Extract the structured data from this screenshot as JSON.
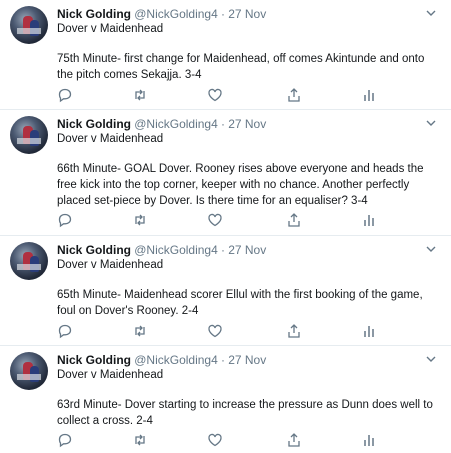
{
  "tweets": [
    {
      "name": "Nick Golding",
      "handle": "@NickGolding4",
      "separator": "·",
      "date": "27 Nov",
      "subtitle": "Dover v Maidenhead",
      "text": "75th Minute- first change for Maidenhead, off comes Akintunde and onto the pitch comes Sekajja. 3-4"
    },
    {
      "name": "Nick Golding",
      "handle": "@NickGolding4",
      "separator": "·",
      "date": "27 Nov",
      "subtitle": "Dover v Maidenhead",
      "text": "66th Minute- GOAL Dover. Rooney rises above everyone and heads the free kick into the top corner, keeper with no chance. Another perfectly placed set-piece by Dover. Is there time for an equaliser? 3-4"
    },
    {
      "name": "Nick Golding",
      "handle": "@NickGolding4",
      "separator": "·",
      "date": "27 Nov",
      "subtitle": "Dover v Maidenhead",
      "text": "65th Minute- Maidenhead scorer Ellul with the first booking of the game, foul on Dover's Rooney. 2-4"
    },
    {
      "name": "Nick Golding",
      "handle": "@NickGolding4",
      "separator": "·",
      "date": "27 Nov",
      "subtitle": "Dover v Maidenhead",
      "text": "63rd Minute- Dover starting to increase the pressure as Dunn does well to collect a cross. 2-4"
    }
  ],
  "icons": {
    "reply": "reply-icon",
    "retweet": "retweet-icon",
    "like": "heart-icon",
    "share": "share-icon",
    "analytics": "analytics-icon",
    "menu": "chevron-down-icon",
    "icon_color": "#657786"
  }
}
